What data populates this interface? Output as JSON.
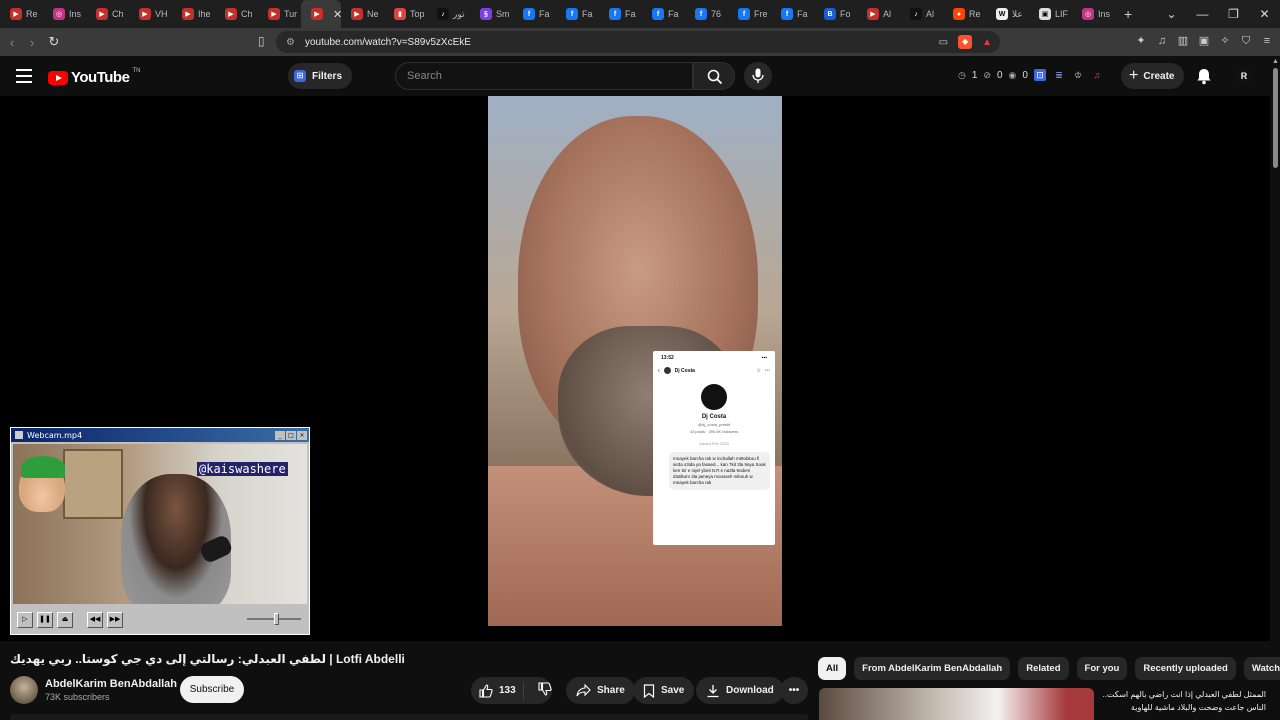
{
  "browser": {
    "tabs": [
      {
        "label": "Re",
        "fav_color": "#c4302b",
        "fav_glyph": "▶"
      },
      {
        "label": "Ins",
        "fav_color": "#c13584",
        "fav_glyph": "◎"
      },
      {
        "label": "Ch",
        "fav_color": "#c4302b",
        "fav_glyph": "▶"
      },
      {
        "label": "VH",
        "fav_color": "#c4302b",
        "fav_glyph": "▶"
      },
      {
        "label": "Ihe",
        "fav_color": "#c4302b",
        "fav_glyph": "▶"
      },
      {
        "label": "Ch",
        "fav_color": "#c4302b",
        "fav_glyph": "▶"
      },
      {
        "label": "Tur",
        "fav_color": "#c4302b",
        "fav_glyph": "▶"
      },
      {
        "label": "",
        "fav_color": "#c4302b",
        "fav_glyph": "▶",
        "active": true
      },
      {
        "label": "Ne",
        "fav_color": "#c4302b",
        "fav_glyph": "▶"
      },
      {
        "label": "Top",
        "fav_color": "#d44",
        "fav_glyph": "▮"
      },
      {
        "label": "تور",
        "fav_color": "#111",
        "fav_glyph": "♪"
      },
      {
        "label": "Sm",
        "fav_color": "#7b3fe4",
        "fav_glyph": "§"
      },
      {
        "label": "Fa",
        "fav_color": "#1877f2",
        "fav_glyph": "f"
      },
      {
        "label": "Fa",
        "fav_color": "#1877f2",
        "fav_glyph": "f"
      },
      {
        "label": "Fa",
        "fav_color": "#1877f2",
        "fav_glyph": "f"
      },
      {
        "label": "Fa",
        "fav_color": "#1877f2",
        "fav_glyph": "f"
      },
      {
        "label": "76",
        "fav_color": "#1877f2",
        "fav_glyph": "f"
      },
      {
        "label": "Fre",
        "fav_color": "#1877f2",
        "fav_glyph": "f"
      },
      {
        "label": "Fa",
        "fav_color": "#1877f2",
        "fav_glyph": "f"
      },
      {
        "label": "Fo",
        "fav_color": "#1a5bd6",
        "fav_glyph": "B"
      },
      {
        "label": "Al",
        "fav_color": "#c4302b",
        "fav_glyph": "▶"
      },
      {
        "label": "Al",
        "fav_color": "#111",
        "fav_glyph": "♪"
      },
      {
        "label": "Re",
        "fav_color": "#ff4500",
        "fav_glyph": "●"
      },
      {
        "label": "علا",
        "fav_color": "#eee",
        "fav_glyph": "W"
      },
      {
        "label": "LIF",
        "fav_color": "#ddd",
        "fav_glyph": "▣"
      },
      {
        "label": "Ins",
        "fav_color": "#c13584",
        "fav_glyph": "◎"
      }
    ],
    "new_tab": "+",
    "window_controls": [
      "⌄",
      "—",
      "❐",
      "✕"
    ],
    "tab_close": "✕",
    "url": "youtube.com/watch?v=S89v5zXcEkE"
  },
  "header": {
    "logo_text": "YouTube",
    "logo_tm": "TN",
    "filters_label": "Filters",
    "search_placeholder": "Search",
    "stats": [
      {
        "icon": "◷",
        "value": "1"
      },
      {
        "icon": "⊘",
        "value": "0"
      },
      {
        "icon": "◉",
        "value": "0"
      }
    ],
    "create_label": "Create",
    "avatar_letter": "R"
  },
  "overlay_card": {
    "time": "13:52",
    "username": "Dj Costa",
    "display_name": "Dj Costa",
    "handle": "@dj_costa_prestit",
    "meta": "43 posts · 390.6K followers",
    "date": "Joined Feb 2020",
    "message": "mnayek barcha rak w inchallah mt9obkou fi se3a s3ida ya fasaed... kan 7kit 3la 9aya Souk ken 5ir e rajel ybeit ts7t e na3la 9odem d3alkom 3la jameya moussel! mibouh w mnayek barcha rak"
  },
  "webcam": {
    "title": "Webcam.mp4",
    "tag": "@kaiswashere",
    "volume": 0.55
  },
  "video": {
    "title": "لطفي العبدلي: رسالتي إلى دي جي كوستا.. ربي يهديك | Lotfi Abdelli",
    "channel_name": "AbdelKarim BenAbdallah",
    "subscribers": "73K subscribers",
    "subscribe_label": "Subscribe",
    "likes": "133",
    "share_label": "Share",
    "save_label": "Save",
    "download_label": "Download"
  },
  "chips": [
    "All",
    "From AbdelKarim BenAbdallah",
    "Related",
    "For you",
    "Recently uploaded",
    "Watched"
  ],
  "recommendation": {
    "title": "الممثل لطفي العبدلي إذا انت راضي بالهم اسكت.. الناس جاعت وضحت والبلاد ماشية للهاوية"
  }
}
